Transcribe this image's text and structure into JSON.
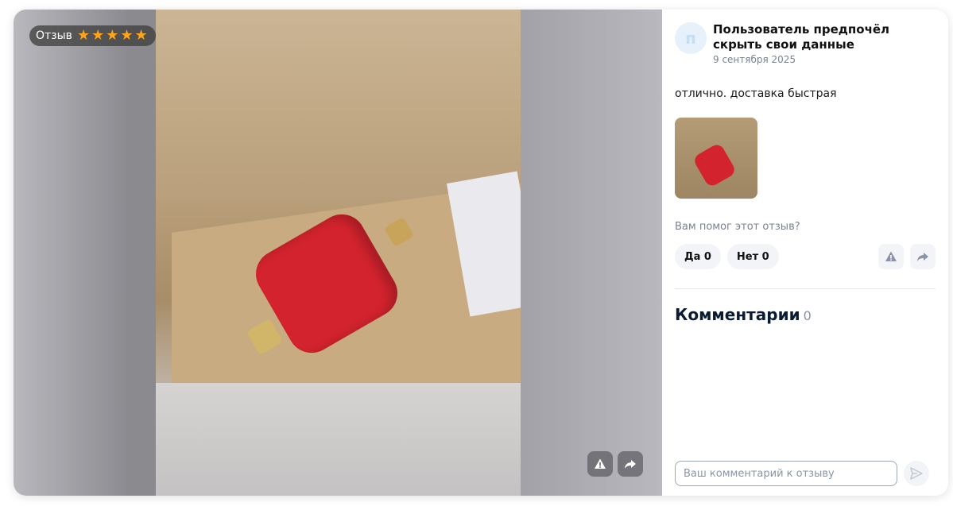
{
  "badge": {
    "label": "Отзыв",
    "rating": 5,
    "max_rating": 5,
    "star_color": "#ffa41c"
  },
  "author": {
    "initial": "п",
    "name": "Пользователь предпочёл скрыть свои данные",
    "date": "9 сентября 2025"
  },
  "review": {
    "text": "отлично. доставка быстрая"
  },
  "helpful": {
    "question": "Вам помог этот отзыв?",
    "yes_label": "Да 0",
    "no_label": "Нет 0"
  },
  "comments": {
    "title": "Комментарии",
    "count": "0",
    "placeholder": "Ваш комментарий к отзыву"
  },
  "icons": {
    "report": "warning-icon",
    "share": "share-icon",
    "send": "send-icon",
    "star": "star-icon"
  }
}
